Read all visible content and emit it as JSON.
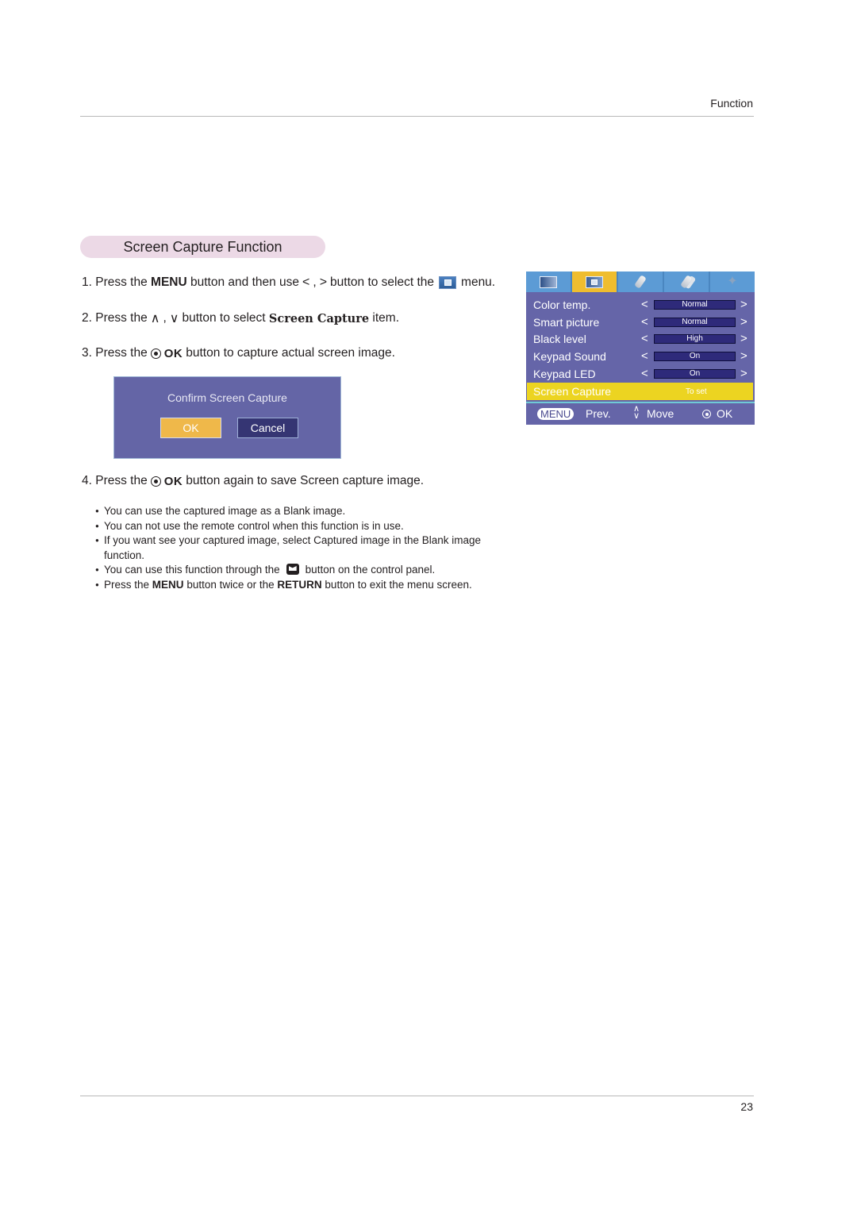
{
  "header": {
    "section_label": "Function"
  },
  "footer": {
    "page_number": "23"
  },
  "section": {
    "title": "Screen Capture Function"
  },
  "steps": [
    {
      "num": "1.",
      "parts": {
        "a": "Press the",
        "b": "MENU",
        "c": "button and then use",
        "left_sym": "<",
        "comma": ",",
        "right_sym": ">",
        "d": "button to select the",
        "e": "menu."
      }
    },
    {
      "num": "2.",
      "parts": {
        "a": "Press the",
        "up_sym": "∧",
        "comma": ",",
        "down_sym": "∨",
        "b": "button to select",
        "c": "Screen Capture",
        "d": "item."
      }
    },
    {
      "num": "3.",
      "parts": {
        "a": "Press the",
        "ok": "OK",
        "b": "button to capture actual screen image."
      }
    },
    {
      "num": "4.",
      "parts": {
        "a": "Press the",
        "ok": "OK",
        "b": "button again to save Screen capture image."
      }
    }
  ],
  "confirm_dialog": {
    "title": "Confirm Screen Capture",
    "ok_label": "OK",
    "cancel_label": "Cancel"
  },
  "osd_menu": {
    "tabs": [
      {
        "icon": "picture-icon",
        "active": false
      },
      {
        "icon": "screen-icon",
        "active": true
      },
      {
        "icon": "tag-icon",
        "active": false
      },
      {
        "icon": "tags-icon",
        "active": false
      },
      {
        "icon": "star-icon",
        "active": false
      }
    ],
    "rows": [
      {
        "label": "Color temp.",
        "value": "Normal"
      },
      {
        "label": "Smart picture",
        "value": "Normal"
      },
      {
        "label": "Black level",
        "value": "High"
      },
      {
        "label": "Keypad Sound",
        "value": "On"
      },
      {
        "label": "Keypad LED",
        "value": "On"
      }
    ],
    "selected_row": {
      "label": "Screen Capture",
      "value": "To set"
    },
    "arrow_left": "<",
    "arrow_right": ">",
    "footer": {
      "menu_key": "MENU",
      "prev": "Prev.",
      "move_icon": "◇",
      "move": "Move",
      "ok": "OK"
    },
    "colors": {
      "background": "#6565a8",
      "tab_bar": "#5c9bd5",
      "active_tab": "#efbd2f",
      "selected_row": "#ecd421",
      "value_box": "#2e2a7a"
    }
  },
  "notes": {
    "b1": "You can use the captured image as a Blank image.",
    "b2": "You can not use the remote control when this function is in use.",
    "b3": "If you want see your captured image, select Captured image in the Blank image function.",
    "b4a": "You can use this function through the",
    "b4b": "button on the control panel.",
    "b5a": "Press the",
    "b5b": "MENU",
    "b5c": "button twice or the",
    "b5d": "RETURN",
    "b5e": "button to exit the menu screen."
  }
}
